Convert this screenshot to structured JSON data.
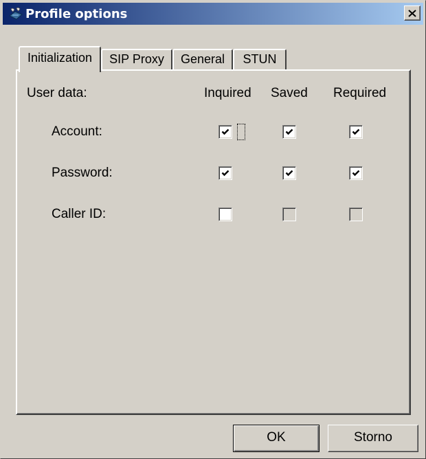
{
  "window": {
    "title": "Profile options",
    "close_glyph": "✕"
  },
  "tabs": [
    {
      "label": "Initialization",
      "active": true
    },
    {
      "label": "SIP Proxy",
      "active": false
    },
    {
      "label": "General",
      "active": false
    },
    {
      "label": "STUN",
      "active": false
    }
  ],
  "panel": {
    "section_label": "User data:",
    "columns": [
      "Inquired",
      "Saved",
      "Required"
    ],
    "rows": [
      {
        "label": "Account:",
        "inquired": true,
        "saved": true,
        "required": true,
        "inquired_focused": true
      },
      {
        "label": "Password:",
        "inquired": true,
        "saved": true,
        "required": true
      },
      {
        "label": "Caller ID:",
        "inquired": false,
        "saved": false,
        "required": false,
        "saved_disabled": true,
        "required_disabled": true
      }
    ]
  },
  "buttons": {
    "ok": "OK",
    "cancel": "Storno"
  },
  "icons": {
    "app": "network-phone-icon",
    "close": "close-icon",
    "check": "checkmark-icon"
  }
}
